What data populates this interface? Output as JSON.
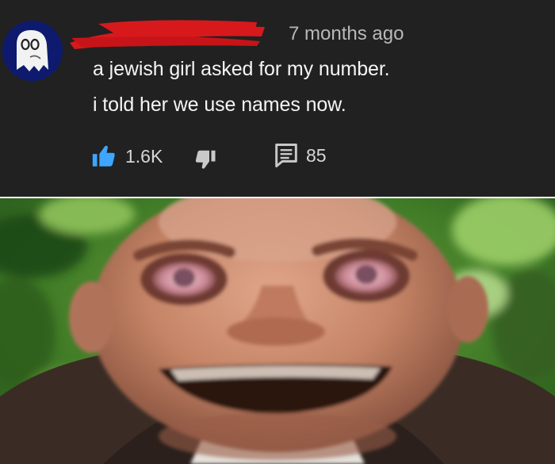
{
  "comment": {
    "author": "",
    "time": "7 months ago",
    "text_line_1": "a jewish girl asked for my number.",
    "text_line_2": "i told her we use names now.",
    "like_count": "1.6K",
    "reply_count": "85",
    "icons": {
      "avatar": "ghost-avatar-icon",
      "like": "thumbs-up-icon",
      "dislike": "thumbs-down-icon",
      "replies": "comment-icon"
    },
    "colors": {
      "background": "#212121",
      "like_active": "#3ea6ff",
      "redaction": "#d7191c"
    }
  },
  "image": {
    "subject": "blurry bald man with wide eyes and open grin in front of green leaves"
  }
}
